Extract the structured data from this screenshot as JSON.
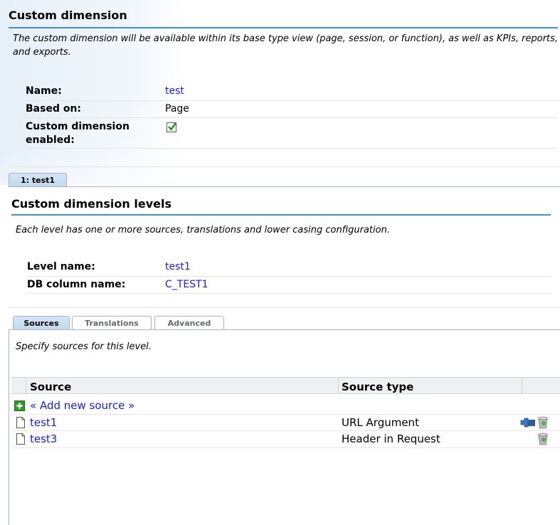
{
  "header": {
    "title": "Custom dimension",
    "description": "The custom dimension will be available within its base type view (page, session, or function), as well as KPIs, reports, and exports."
  },
  "fields": {
    "name_label": "Name:",
    "name_value": "test",
    "based_on_label": "Based on:",
    "based_on_value": "Page",
    "enabled_label_1": "Custom dimension",
    "enabled_label_2": "enabled:",
    "enabled_checked": true
  },
  "level_tab": {
    "label": "1: test1"
  },
  "levels": {
    "title": "Custom dimension levels",
    "description": "Each level has one or more sources, translations and lower casing configuration.",
    "level_name_label": "Level name:",
    "level_name_value": "test1",
    "db_column_label": "DB column name:",
    "db_column_value": "C_TEST1"
  },
  "subtabs": [
    {
      "label": "Sources",
      "active": true
    },
    {
      "label": "Translations",
      "active": false
    },
    {
      "label": "Advanced",
      "active": false
    }
  ],
  "sources": {
    "instruction": "Specify sources for this level.",
    "columns": [
      "Source",
      "Source type"
    ],
    "add_label": "« Add new source »",
    "rows": [
      {
        "name": "test1",
        "type": "URL Argument",
        "actions": [
          "plugin-icon",
          "trash-icon"
        ]
      },
      {
        "name": "test3",
        "type": "Header in Request",
        "actions": [
          "trash-icon"
        ]
      }
    ]
  },
  "colors": {
    "accent_rule": "#3a8fd6",
    "link": "#1a1aee",
    "tab_active": "#c2d8ec"
  }
}
